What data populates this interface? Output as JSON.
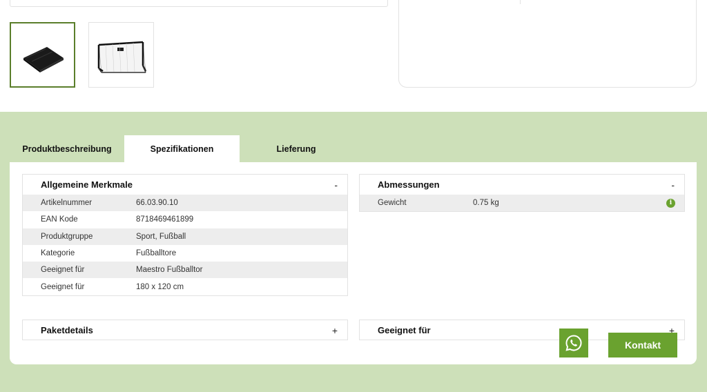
{
  "gallery": {
    "thumbnails": [
      {
        "icon": "goal-net-folded-image"
      },
      {
        "icon": "soccer-goal-image"
      }
    ]
  },
  "tabs": [
    {
      "label": "Produktbeschreibung",
      "active": false
    },
    {
      "label": "Spezifikationen",
      "active": true
    },
    {
      "label": "Lieferung",
      "active": false
    }
  ],
  "sections": {
    "allgemeine": {
      "title": "Allgemeine Merkmale",
      "toggle": "-",
      "rows": [
        {
          "key": "Artikelnummer",
          "value": "66.03.90.10"
        },
        {
          "key": "EAN Kode",
          "value": "8718469461899"
        },
        {
          "key": "Produktgruppe",
          "value": "Sport, Fußball"
        },
        {
          "key": "Kategorie",
          "value": "Fußballtore"
        },
        {
          "key": "Geeignet für",
          "value": "Maestro Fußballtor"
        },
        {
          "key": "Geeignet für",
          "value": "180 x 120 cm"
        }
      ]
    },
    "abmessungen": {
      "title": "Abmessungen",
      "toggle": "-",
      "rows": [
        {
          "key": "Gewicht",
          "value": "0.75 kg",
          "info_icon": "i"
        }
      ]
    },
    "paketdetails": {
      "title": "Paketdetails",
      "toggle": "+"
    },
    "geeignet": {
      "title": "Geeignet für",
      "toggle": "+"
    }
  },
  "floating": {
    "whatsapp_icon": "whatsapp-icon",
    "kontakt_label": "Kontakt"
  },
  "colors": {
    "accent": "#6aa22f",
    "band": "#cde0b9",
    "active_thumb_border": "#5a7e2a"
  }
}
